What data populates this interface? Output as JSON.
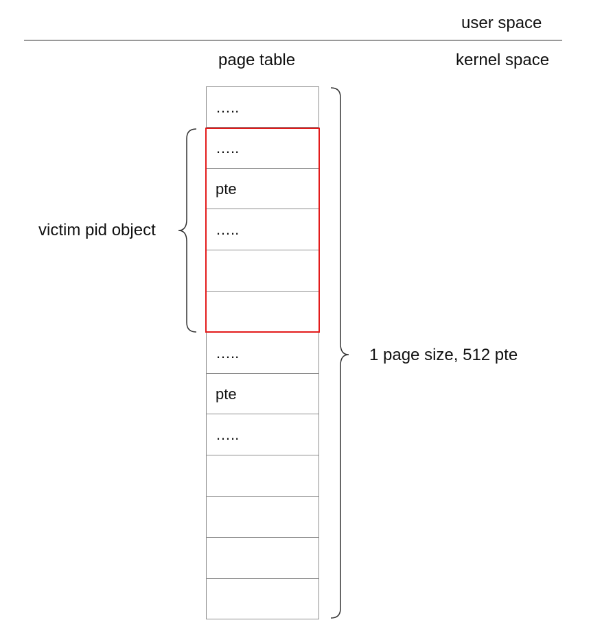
{
  "labels": {
    "user_space": "user space",
    "kernel_space": "kernel space",
    "page_table": "page table",
    "victim": "victim pid object",
    "page_size": "1 page size, 512 pte"
  },
  "page_table": {
    "rows": [
      "…..",
      "…..",
      "pte",
      "…..",
      "",
      "",
      "…..",
      "pte",
      "…..",
      "",
      "",
      "",
      ""
    ],
    "highlight_range": [
      1,
      5
    ],
    "highlight_color": "#e31b1b",
    "border_color": "#8c8c8c"
  }
}
